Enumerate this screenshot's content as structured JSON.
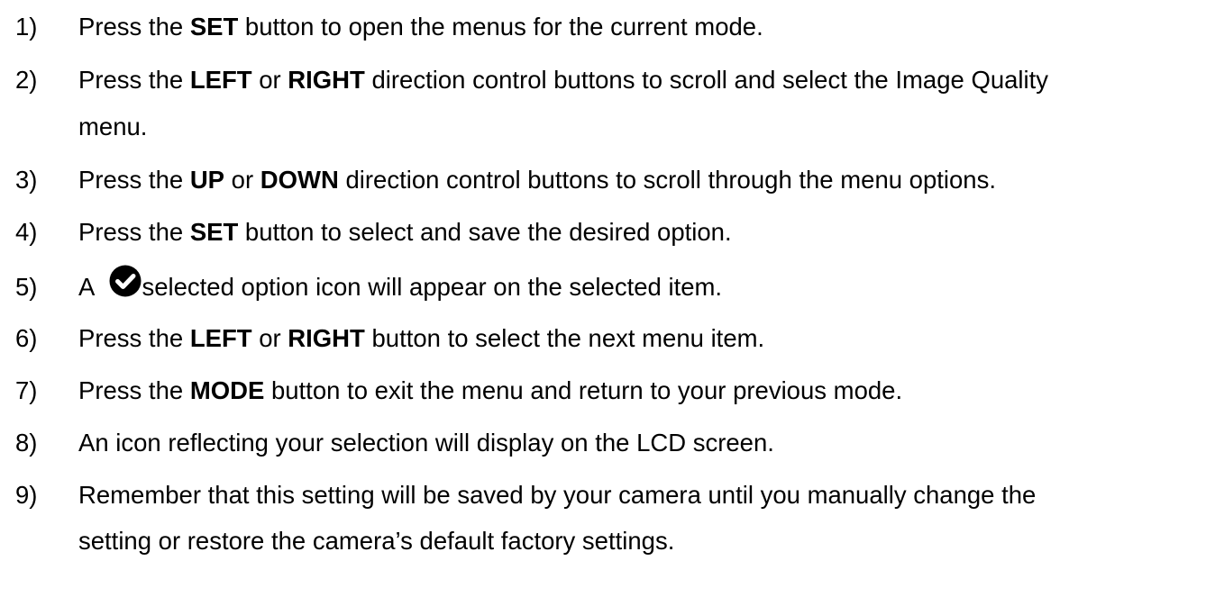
{
  "steps": [
    {
      "num": "1)",
      "parts": [
        {
          "t": "Press the "
        },
        {
          "t": "SET",
          "b": true
        },
        {
          "t": " button to open the menus for the current mode."
        }
      ]
    },
    {
      "num": "2)",
      "parts": [
        {
          "t": "Press the "
        },
        {
          "t": "LEFT",
          "b": true
        },
        {
          "t": " or "
        },
        {
          "t": "RIGHT",
          "b": true
        },
        {
          "t": " direction control buttons to scroll and select the Image Quality"
        }
      ],
      "continuation": "menu."
    },
    {
      "num": "3)",
      "parts": [
        {
          "t": "Press the "
        },
        {
          "t": "UP",
          "b": true
        },
        {
          "t": " or "
        },
        {
          "t": "DOWN",
          "b": true
        },
        {
          "t": " direction control buttons to scroll through the menu options."
        }
      ]
    },
    {
      "num": "4)",
      "parts": [
        {
          "t": "Press the "
        },
        {
          "t": "SET",
          "b": true
        },
        {
          "t": " button to select and save the desired option."
        }
      ]
    },
    {
      "num": "5)",
      "parts": [
        {
          "t": "A "
        },
        {
          "icon": "check-circle-icon"
        },
        {
          "t": "selected option icon will appear on the selected item."
        }
      ]
    },
    {
      "num": "6)",
      "parts": [
        {
          "t": "Press the "
        },
        {
          "t": "LEFT",
          "b": true
        },
        {
          "t": " or "
        },
        {
          "t": "RIGHT",
          "b": true
        },
        {
          "t": " button to select the next menu item."
        }
      ]
    },
    {
      "num": "7)",
      "parts": [
        {
          "t": "Press the "
        },
        {
          "t": "MODE",
          "b": true
        },
        {
          "t": " button to exit the menu and return to your previous mode."
        }
      ]
    },
    {
      "num": "8)",
      "parts": [
        {
          "t": "An icon reflecting your selection will display on the LCD screen."
        }
      ]
    },
    {
      "num": "9)",
      "parts": [
        {
          "t": "Remember that this setting will be saved by your camera until you manually change the"
        }
      ],
      "continuation": "setting or restore the camera’s default factory settings."
    }
  ],
  "icon_color": "#000000",
  "text_color": "#000000"
}
